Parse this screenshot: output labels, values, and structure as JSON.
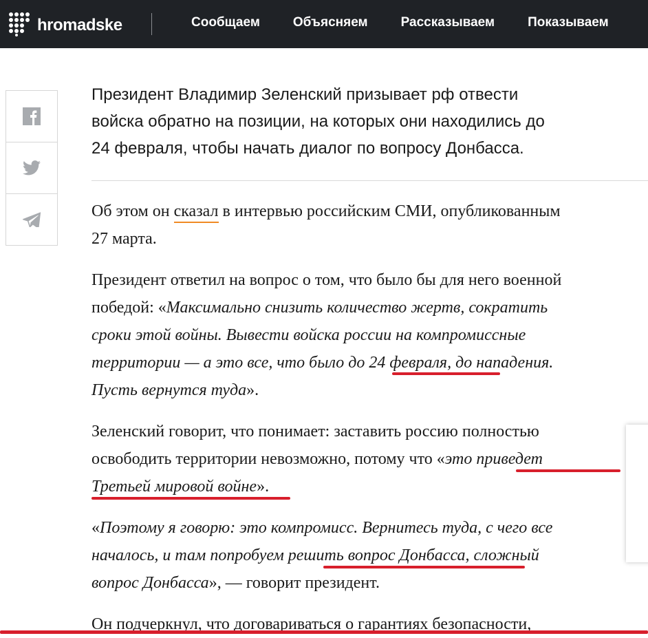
{
  "header": {
    "logo_text": "hromadske",
    "nav": [
      "Сообщаем",
      "Объясняем",
      "Рассказываем",
      "Показываем"
    ]
  },
  "article": {
    "lead": [
      "Президент Владимир Зеленский призывает рф отвести",
      "войска обратно на позиции, на которых они находились до",
      "24 февраля, чтобы начать диалог по вопросу Донбасса."
    ],
    "p1": {
      "a": "Об этом он ",
      "link": "сказал",
      "b": " в интервью российским СМИ, опубликованным",
      "line2": "27 марта."
    },
    "p2": {
      "l1": "Президент ответил на вопрос о том, что было бы для него военной",
      "l2a": "победой: «",
      "l2b": "Максимально снизить количество жертв, сократить",
      "l3": "сроки этой войны. Вывести войска россии на компромиссные",
      "l4": "территории — а это все, что было до 24 февраля, до нападения.",
      "l5a": "Пусть вернутся туда",
      "l5b": "»."
    },
    "p3": {
      "l1": "Зеленский говорит, что понимает: заставить россию полностью",
      "l2a": "освободить территории невозможно, потому что «",
      "l2b": "это приведет",
      "l3a": "Третьей мировой войне",
      "l3b": "»."
    },
    "p4": {
      "l1a": "«",
      "l1b": "Поэтому я говорю: это компромисс. Вернитесь туда, с чего все",
      "l2": "началось, и там попробуем решить вопрос Донбасса, сложный",
      "l3a": "вопрос Донбасса",
      "l3b": "», — говорит президент."
    },
    "p5": {
      "l1": "Он подчеркнул, что договариваться о гарантиях безопасности,"
    }
  }
}
